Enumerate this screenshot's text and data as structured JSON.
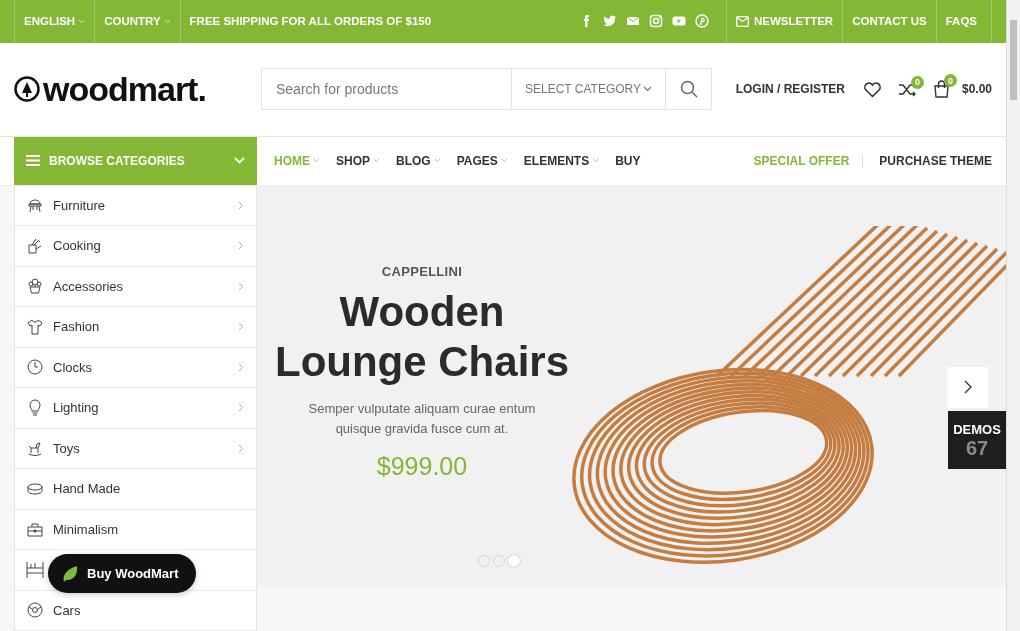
{
  "topbar": {
    "language": "ENGLISH",
    "country": "COUNTRY",
    "shipping_message": "FREE SHIPPING FOR ALL ORDERS OF $150",
    "links": [
      {
        "kind": "icon-text",
        "label": "NEWSLETTER"
      },
      {
        "kind": "text",
        "label": "CONTACT US"
      },
      {
        "kind": "text",
        "label": "FAQS"
      }
    ]
  },
  "header": {
    "logo": "woodmart.",
    "search": {
      "placeholder": "Search for products",
      "category": "SELECT CATEGORY"
    },
    "account": "LOGIN / REGISTER",
    "compare_count": "0",
    "cart_count": "0",
    "cart_total": "$0.00"
  },
  "categories": {
    "title": "BROWSE CATEGORIES",
    "items": [
      {
        "label": "Furniture",
        "has_submenu": true
      },
      {
        "label": "Cooking",
        "has_submenu": true
      },
      {
        "label": "Accessories",
        "has_submenu": true
      },
      {
        "label": "Fashion",
        "has_submenu": true
      },
      {
        "label": "Clocks",
        "has_submenu": true
      },
      {
        "label": "Lighting",
        "has_submenu": true
      },
      {
        "label": "Toys",
        "has_submenu": true
      },
      {
        "label": "Hand Made",
        "has_submenu": false
      },
      {
        "label": "Minimalism",
        "has_submenu": false
      },
      {
        "has_submenu": false
      },
      {
        "label": "Cars",
        "has_submenu": false
      }
    ]
  },
  "nav": {
    "items": [
      {
        "label": "HOME",
        "selected": true,
        "has_dropdown": true
      },
      {
        "label": "SHOP",
        "selected": false,
        "has_dropdown": true
      },
      {
        "label": "BLOG",
        "selected": false,
        "has_dropdown": true
      },
      {
        "label": "PAGES",
        "selected": false,
        "has_dropdown": true
      },
      {
        "label": "ELEMENTS",
        "selected": false,
        "has_dropdown": true
      },
      {
        "label": "BUY",
        "selected": false,
        "has_dropdown": false
      }
    ],
    "special_offer": "SPECIAL OFFER",
    "purchase": "PURCHASE THEME"
  },
  "hero": {
    "brand": "CAPPELLINI",
    "title": "Wooden Lounge Chairs",
    "description": "Semper vulputate aliquam curae entum quisque gravida fusce cum at.",
    "price": "$999.00",
    "dots": [
      {
        "selected": false
      },
      {
        "selected": false
      },
      {
        "selected": true
      }
    ]
  },
  "demos": {
    "label": "DEMOS",
    "count": "67"
  },
  "buy_button": "Buy WoodMart"
}
